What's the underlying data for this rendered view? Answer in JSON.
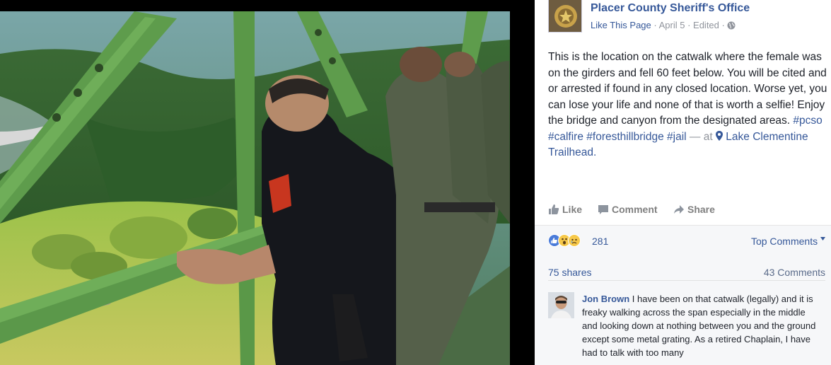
{
  "photo": {
    "alt_subject": "officers-on-bridge-catwalk",
    "patch_text": "FIRE"
  },
  "post": {
    "page_name": "Placer County Sheriff's Office",
    "like_page": "Like This Page",
    "sep1": " · ",
    "date": "April 5",
    "sep2": " · ",
    "edited": "Edited",
    "sep3": " · ",
    "text_main": "This is the location on the catwalk where the female was on the girders and fell 60 feet below. You will be cited and or arrested if found in any closed location. Worse yet, you can lose your life and none of that is worth a selfie! Enjoy the bridge and canyon from the designated areas.",
    "hashtags": [
      "#pcso",
      "#calfire",
      "#foresthillbridge",
      "#jail"
    ],
    "at_text": "— at",
    "place": "Lake Clementine Trailhead."
  },
  "actions": {
    "like": "Like",
    "comment": "Comment",
    "share": "Share"
  },
  "stats": {
    "reactions": [
      "like",
      "wow",
      "sad"
    ],
    "reaction_count": "281",
    "top_comments": "Top Comments",
    "shares": "75 shares",
    "comments": "43 Comments"
  },
  "comment": {
    "author": "Jon Brown",
    "text": "I have been on that catwalk (legally) and it is freaky walking across the span especially in the middle and looking down at nothing between you and the ground except some metal grating. As a retired Chaplain, I have had to talk with too many"
  },
  "colors": {
    "link": "#365899",
    "meta": "#90949c",
    "bridge_green": "#5f9f4a",
    "background": "#000000"
  }
}
